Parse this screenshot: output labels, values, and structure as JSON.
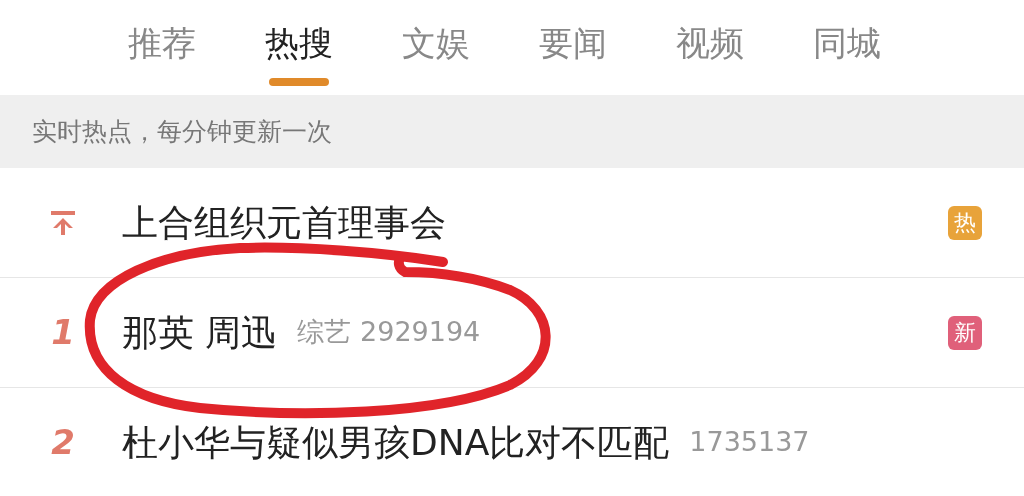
{
  "tabs": [
    {
      "label": "推荐",
      "selected": false
    },
    {
      "label": "热搜",
      "selected": true
    },
    {
      "label": "文娱",
      "selected": false
    },
    {
      "label": "要闻",
      "selected": false
    },
    {
      "label": "视频",
      "selected": false
    },
    {
      "label": "同城",
      "selected": false
    }
  ],
  "banner": "实时热点，每分钟更新一次",
  "items": [
    {
      "kind": "pinned",
      "title": "上合组织元首理事会",
      "badge": {
        "text": "热",
        "color": "#e8a33a"
      }
    },
    {
      "kind": "ranked",
      "rank": "1",
      "title": "那英 周迅",
      "meta": "综艺 2929194",
      "badge": {
        "text": "新",
        "color": "#e0607a"
      }
    },
    {
      "kind": "ranked",
      "rank": "2",
      "title": "杜小华与疑似男孩DNA比对不匹配",
      "meta": "1735137"
    }
  ]
}
